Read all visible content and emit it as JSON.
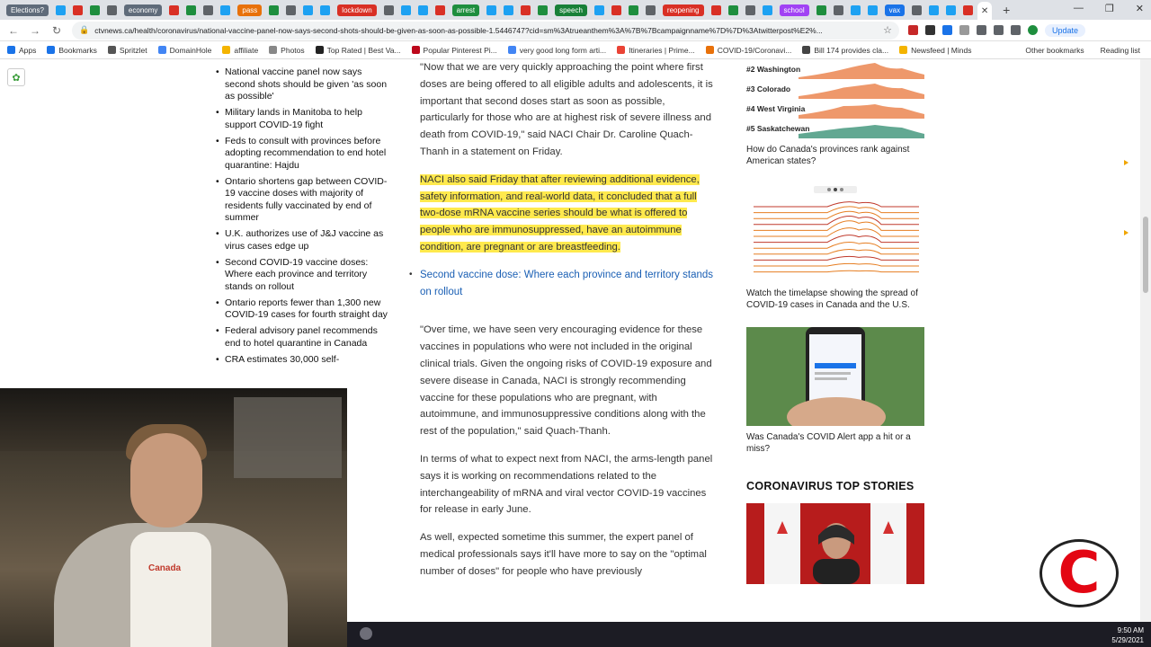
{
  "browser": {
    "tabs": [
      {
        "label": "Elections?",
        "color": "#5f6b7a"
      },
      {
        "label": "economy",
        "color": "#5f6b7a"
      },
      {
        "label": "pass",
        "color": "#e8710a"
      },
      {
        "label": "lockdown",
        "color": "#d93025"
      },
      {
        "label": "arrest",
        "color": "#1e8e3e"
      },
      {
        "label": "speech",
        "color": "#188038"
      },
      {
        "label": "reopening",
        "color": "#d93025"
      },
      {
        "label": "school",
        "color": "#a142f4"
      },
      {
        "label": "vax",
        "color": "#1a73e8"
      }
    ],
    "url": "ctvnews.ca/health/coronavirus/national-vaccine-panel-now-says-second-shots-should-be-given-as-soon-as-possible-1.5446747?cid=sm%3Atrueanthem%3A%7B%7Bcampaignname%7D%7D%3Atwitterpost%E2%...",
    "update_label": "Update",
    "bookmarks": [
      "Apps",
      "Bookmarks",
      "Spritzlet",
      "DomainHole",
      "affiliate",
      "Photos",
      "Top Rated | Best Va...",
      "Popular Pinterest Pi...",
      "very good long form arti...",
      "Itineraries | Prime...",
      "COVID-19/Coronavi...",
      "Bill 174 provides cla...",
      "Newsfeed | Minds"
    ],
    "bookmarks_right": [
      "Other bookmarks",
      "Reading list"
    ]
  },
  "sidebar": {
    "related": [
      "National vaccine panel now says second shots should be given 'as soon as possible'",
      "Military lands in Manitoba to help support COVID-19 fight",
      "Feds to consult with provinces before adopting recommendation to end hotel quarantine: Hajdu",
      "Ontario shortens gap between COVID-19 vaccine doses with majority of residents fully vaccinated by end of summer",
      "U.K. authorizes use of J&J vaccine as virus cases edge up",
      "Second COVID-19 vaccine doses: Where each province and territory stands on rollout",
      "Ontario reports fewer than 1,300 new COVID-19 cases for fourth straight day",
      "Federal advisory panel recommends end to hotel quarantine in Canada",
      "CRA estimates 30,000 self-"
    ]
  },
  "article": {
    "p1": "\"Now that we are very quickly approaching the point where first doses are being offered to all eligible adults and adolescents, it is important that second doses start as soon as possible, particularly for those who are at highest risk of severe illness and death from COVID-19,\" said NACI Chair Dr. Caroline Quach-Thanh in a statement on Friday.",
    "p2_highlighted": "NACI also said Friday that after reviewing additional evidence, safety information, and real-world data, it concluded that a full two-dose mRNA vaccine series should be what is offered to people who are immunosuppressed, have an autoimmune condition, are pregnant or are breastfeeding.",
    "link": "Second vaccine dose: Where each province and territory stands on rollout",
    "p3": "\"Over time, we have seen very encouraging evidence for these vaccines in populations who were not included in the original clinical trials. Given the ongoing risks of COVID-19 exposure and severe disease in Canada, NACI is strongly recommending vaccine for these populations who are pregnant, with autoimmune, and immunosuppressive conditions along with the rest of the population,\" said Quach-Thanh.",
    "p4": "In terms of what to expect next from NACI, the arms-length panel says it is working on recommendations related to the interchangeability of mRNA and viral vector COVID-19 vaccines for release in early June.",
    "p5": "As well, expected sometime this summer, the expert panel of medical professionals says it'll have more to say on the \"optimal number of doses\" for people who have previously"
  },
  "rail": {
    "ranks": [
      "#2 Washington",
      "#3 Colorado",
      "#4 West Virginia",
      "#5 Saskatchewan"
    ],
    "caption1": "How do Canada's provinces rank against American states?",
    "caption2": "Watch the timelapse showing the spread of COVID-19 cases in Canada and the U.S.",
    "caption3": "Was Canada's COVID Alert app a hit or a miss?",
    "section_title": "CORONAVIRUS TOP STORIES"
  },
  "webcam": {
    "shirt_text": "Canada"
  },
  "taskbar": {
    "time": "9:50 AM",
    "date": "5/29/2021"
  },
  "logo": {
    "letter": "C"
  }
}
